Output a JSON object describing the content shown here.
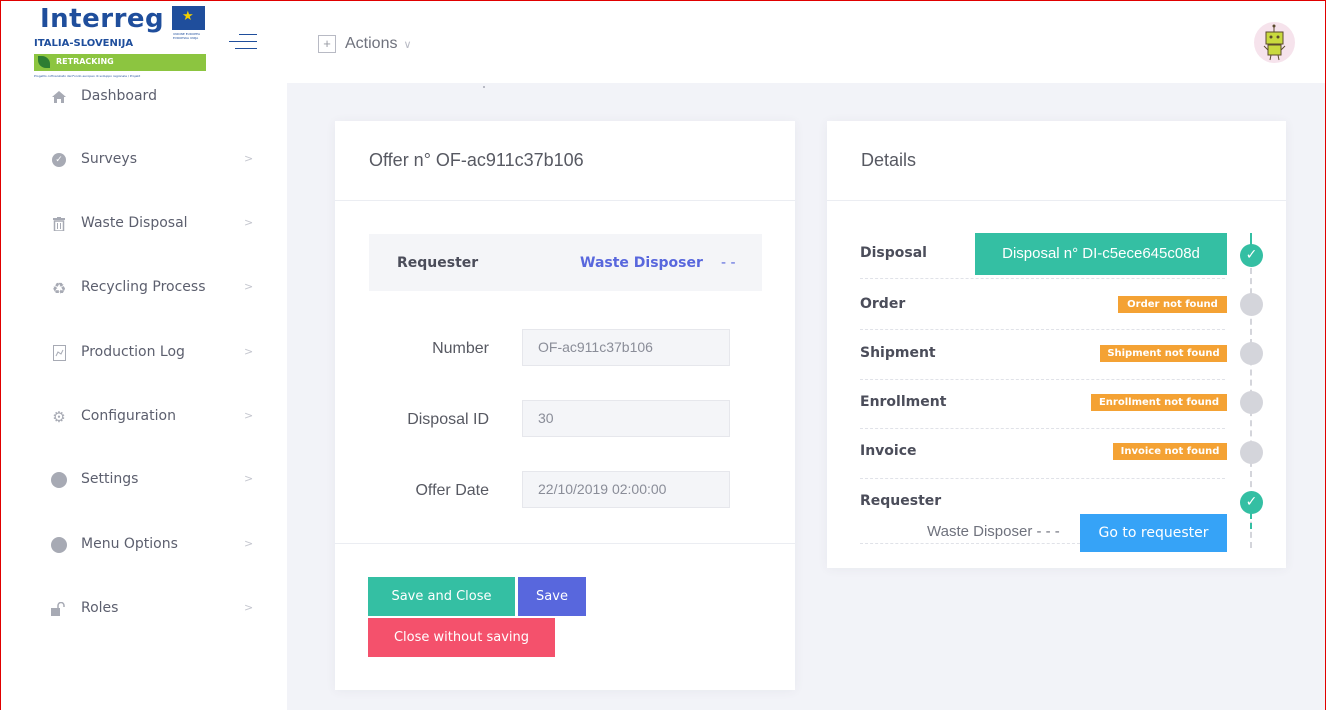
{
  "header": {
    "logo": {
      "title": "Interreg",
      "subtitle": "ITALIA-SLOVENIJA",
      "project": "RETRACKING",
      "small_text": "Progetto cofinanziato dal Fondo europeo di sviluppo regionale / Projekt sofinancira Evropski sklad za regionalni razvoj",
      "eu_text": "UNIONE EUROPEA EVROPSKA UNIJA"
    },
    "actions_label": "Actions",
    "avatar_alt": "user avatar"
  },
  "sidebar": {
    "items": [
      {
        "label": "Dashboard",
        "icon": "home-icon",
        "has_children": false
      },
      {
        "label": "Surveys",
        "icon": "check-circle-icon",
        "has_children": true
      },
      {
        "label": "Waste Disposal",
        "icon": "trash-icon",
        "has_children": true
      },
      {
        "label": "Recycling Process",
        "icon": "recycle-icon",
        "has_children": true
      },
      {
        "label": "Production Log",
        "icon": "chart-doc-icon",
        "has_children": true
      },
      {
        "label": "Configuration",
        "icon": "gears-icon",
        "has_children": true
      },
      {
        "label": "Settings",
        "icon": "dot-icon",
        "has_children": true
      },
      {
        "label": "Menu Options",
        "icon": "dot-icon",
        "has_children": true
      },
      {
        "label": "Roles",
        "icon": "unlock-icon",
        "has_children": true
      }
    ]
  },
  "offer": {
    "title": "Offer n° OF-ac911c37b106",
    "requester_label": "Requester",
    "requester_value": "Waste Disposer",
    "requester_suffix": "- -",
    "fields": [
      {
        "label": "Number",
        "value": "OF-ac911c37b106"
      },
      {
        "label": "Disposal ID",
        "value": "30"
      },
      {
        "label": "Offer Date",
        "value": "22/10/2019 02:00:00"
      }
    ],
    "buttons": {
      "save_close": "Save and Close",
      "save": "Save",
      "close_no_save": "Close without saving"
    }
  },
  "details": {
    "title": "Details",
    "rows": [
      {
        "label": "Disposal",
        "status": "done"
      },
      {
        "label": "Order",
        "badge": "Order not found",
        "status": "todo"
      },
      {
        "label": "Shipment",
        "badge": "Shipment not found",
        "status": "todo"
      },
      {
        "label": "Enrollment",
        "badge": "Enrollment not found",
        "status": "todo"
      },
      {
        "label": "Invoice",
        "badge": "Invoice not found",
        "status": "todo"
      },
      {
        "label": "Requester",
        "status": "done"
      }
    ],
    "disposal_button": "Disposal n° DI-c5ece645c08d",
    "requester_text": "Waste Disposer - - -",
    "goto_button": "Go to requester"
  },
  "colors": {
    "success": "#34bfa3",
    "primary": "#5867dd",
    "danger": "#f4516c",
    "warning": "#f4a234",
    "info": "#36a3f7"
  }
}
